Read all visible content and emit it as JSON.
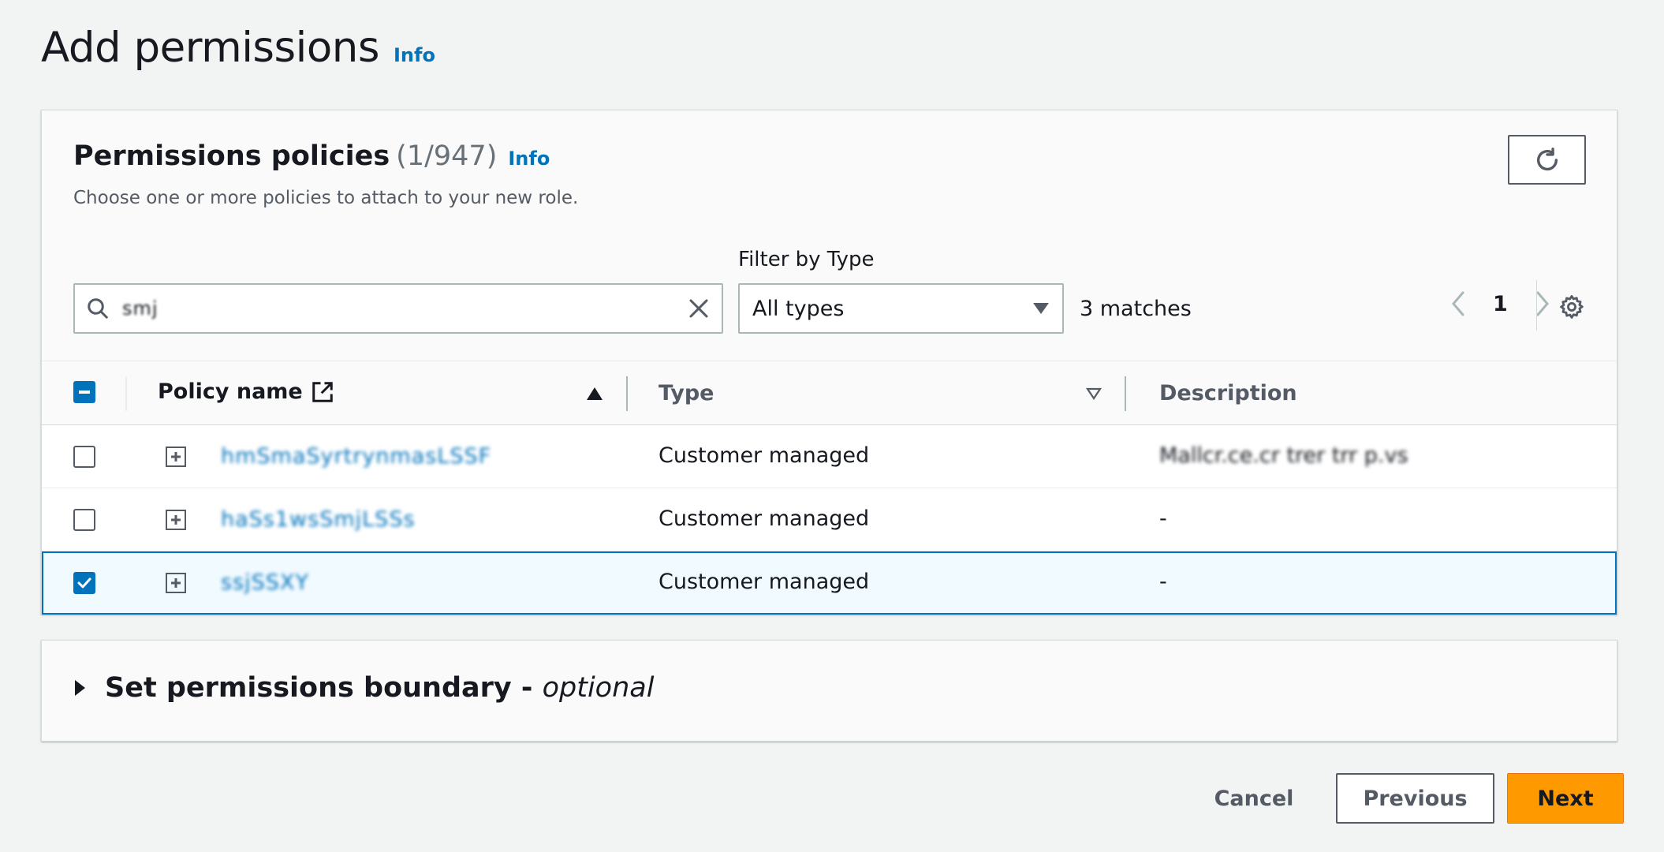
{
  "page": {
    "title": "Add permissions",
    "info": "Info"
  },
  "policies": {
    "title": "Permissions policies",
    "count": "(1/947)",
    "info": "Info",
    "description": "Choose one or more policies to attach to your new role.",
    "filter_label": "Filter by Type",
    "search_value": "smj",
    "filter_value": "All types",
    "matches": "3 matches",
    "page_number": "1",
    "columns": {
      "name": "Policy name",
      "type": "Type",
      "description": "Description"
    },
    "rows": [
      {
        "name": "hmSmaSyrtrynmasLSSF",
        "type": "Customer managed",
        "description": "Mallcr.ce.cr trer trr p.vs",
        "selected": false
      },
      {
        "name": "haSs1wsSmjLSSs",
        "type": "Customer managed",
        "description": "-",
        "selected": false
      },
      {
        "name": "ssjSSXY",
        "type": "Customer managed",
        "description": "-",
        "selected": true
      }
    ]
  },
  "boundary": {
    "title": "Set permissions boundary -",
    "optional": "optional"
  },
  "footer": {
    "cancel": "Cancel",
    "previous": "Previous",
    "next": "Next"
  },
  "colors": {
    "accent": "#0073bb",
    "primary_button": "#ff9900"
  }
}
